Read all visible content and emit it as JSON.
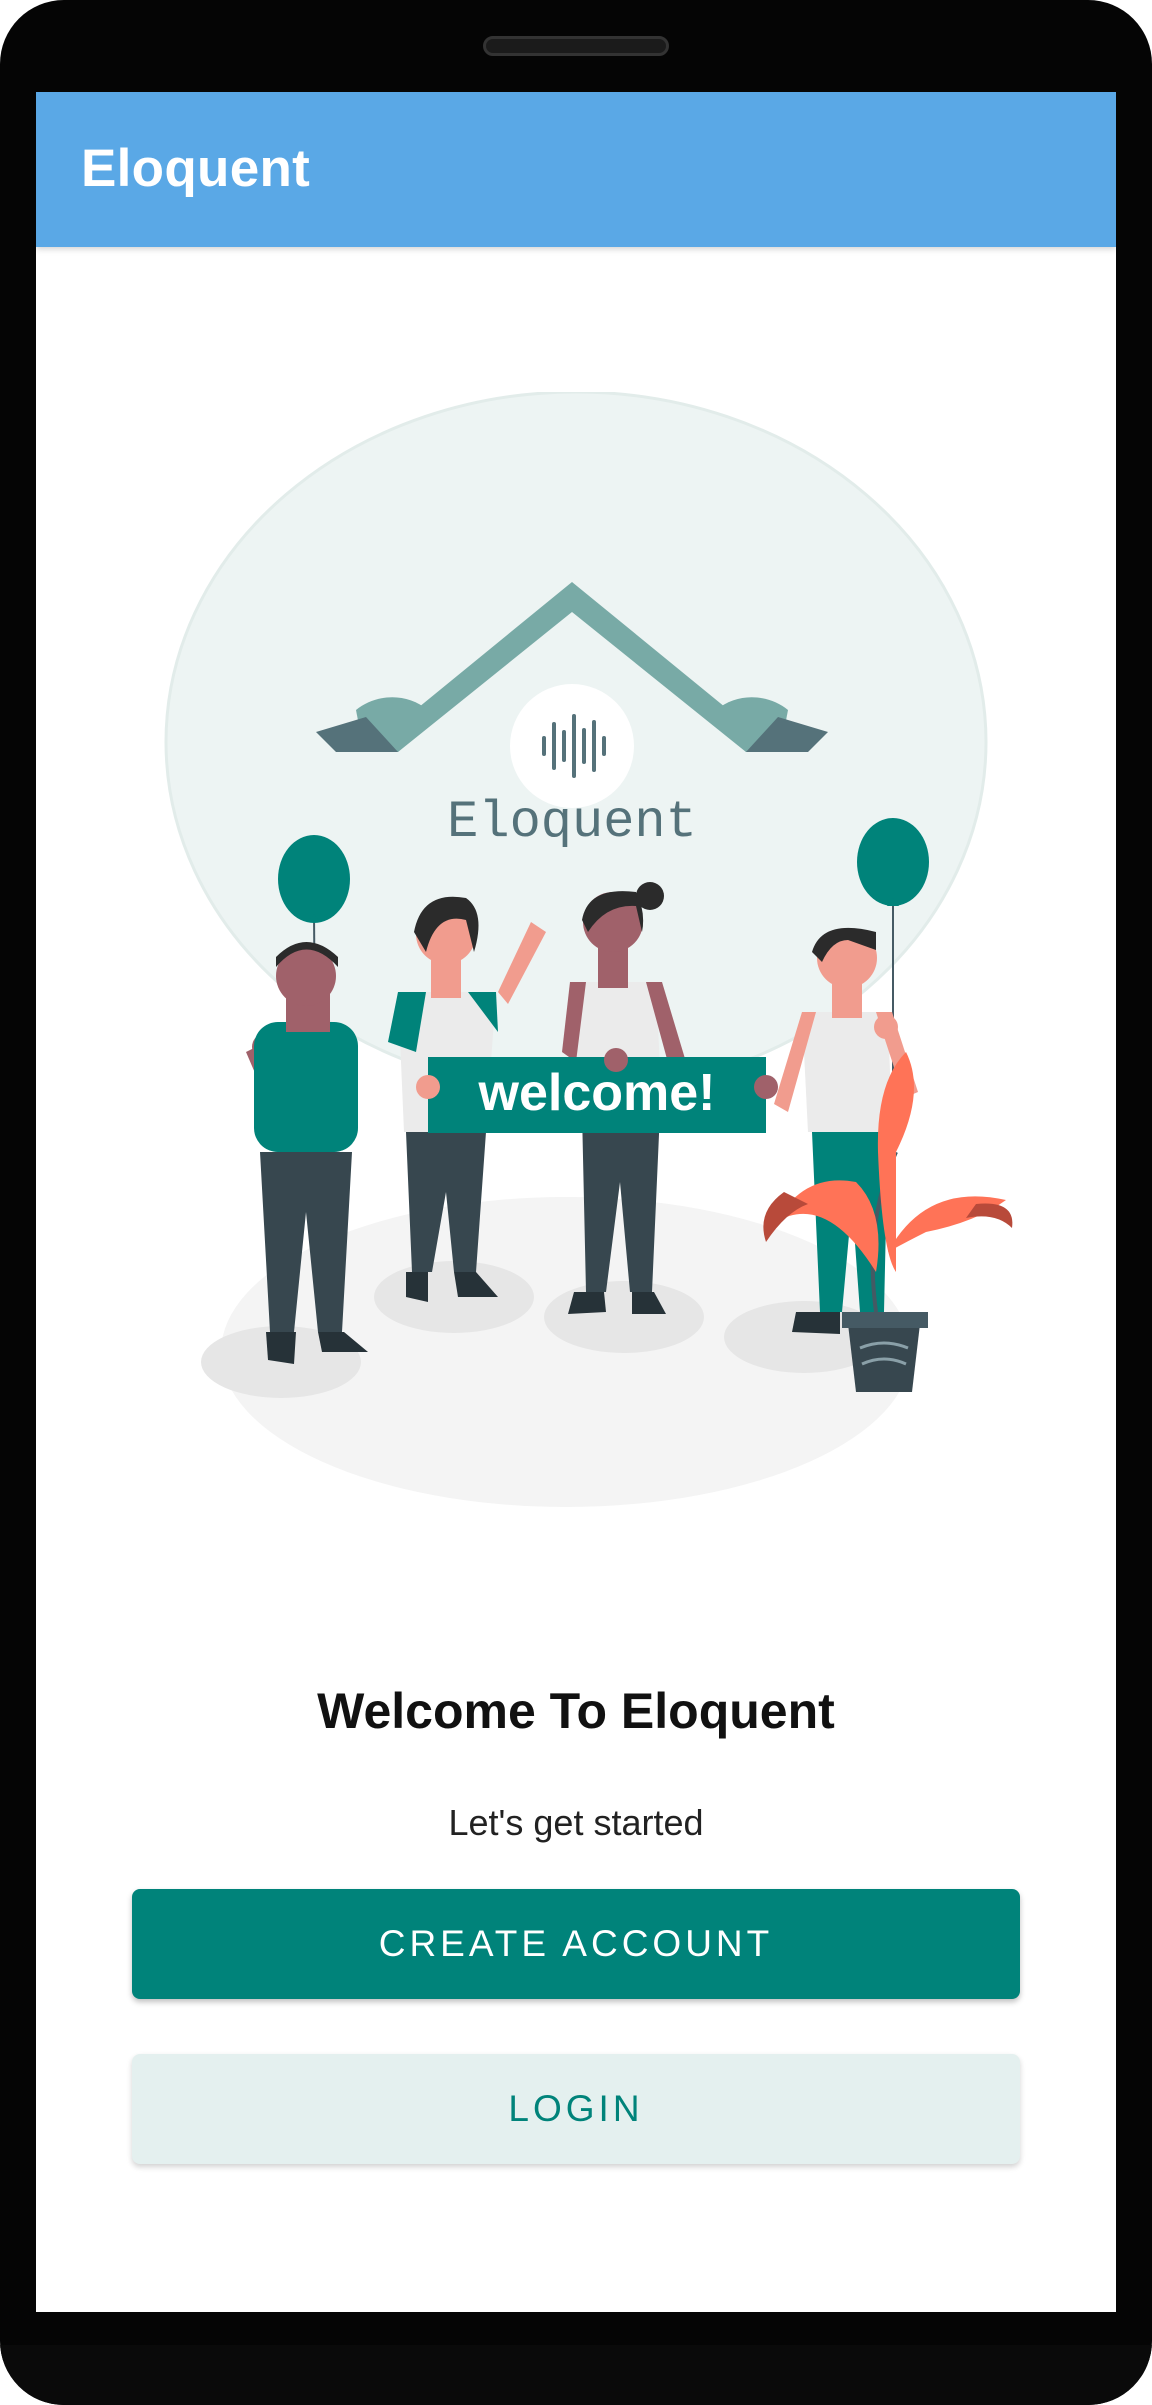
{
  "app": {
    "title": "Eloquent"
  },
  "hero": {
    "logo_text": "Eloquent",
    "banner_text": "welcome!"
  },
  "main": {
    "heading": "Welcome To Eloquent",
    "subtitle": "Let's get started",
    "create_account_label": "CREATE ACCOUNT",
    "login_label": "LOGIN"
  },
  "colors": {
    "appbar": "#5aa8e6",
    "primary": "#00837a",
    "secondary_bg": "#e4f0ef"
  }
}
